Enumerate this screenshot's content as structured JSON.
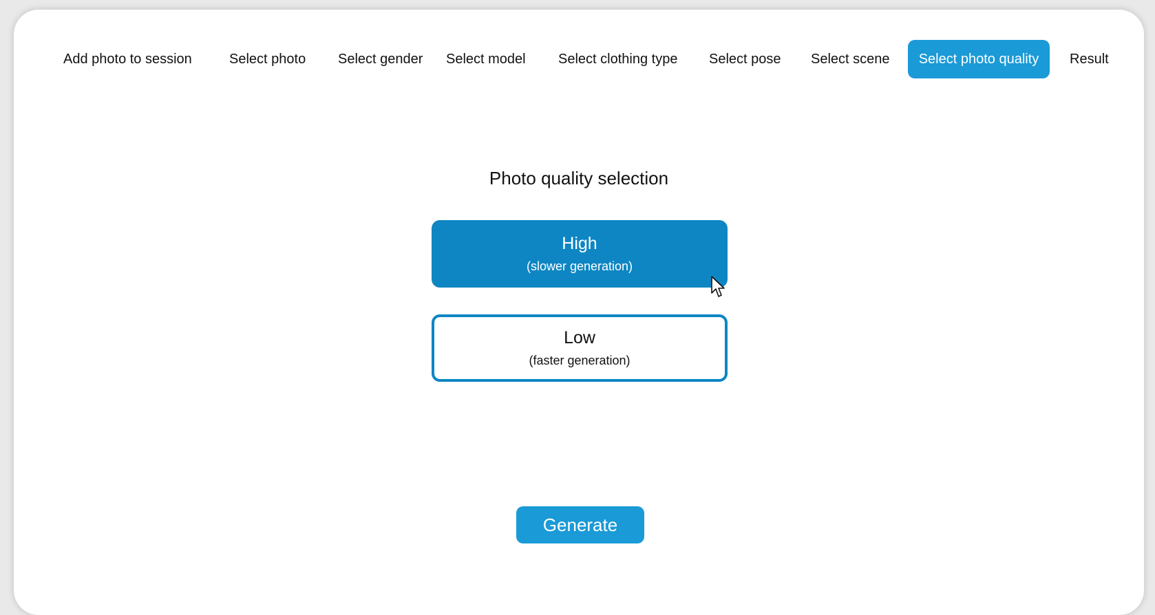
{
  "colors": {
    "accent": "#1a9ad7",
    "accent_dark": "#0e86c3",
    "border": "#0e86c3"
  },
  "steps": [
    {
      "label": "Add photo to session",
      "active": false
    },
    {
      "label": "Select photo",
      "active": false
    },
    {
      "label": "Select gender",
      "active": false
    },
    {
      "label": "Select model",
      "active": false
    },
    {
      "label": "Select clothing type",
      "active": false
    },
    {
      "label": "Select pose",
      "active": false
    },
    {
      "label": "Select scene",
      "active": false
    },
    {
      "label": "Select photo quality",
      "active": true
    },
    {
      "label": "Result",
      "active": false
    }
  ],
  "main": {
    "heading": "Photo quality selection",
    "options": [
      {
        "label": "High",
        "sub": "(slower generation)",
        "selected": true
      },
      {
        "label": "Low",
        "sub": "(faster generation)",
        "selected": false
      }
    ],
    "generate_label": "Generate"
  }
}
